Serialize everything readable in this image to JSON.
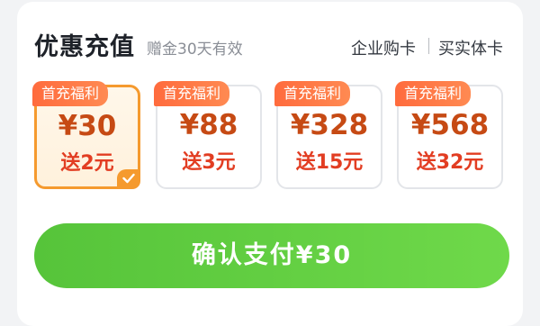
{
  "header": {
    "title": "优惠充值",
    "subtitle": "赠金30天有效",
    "link_corporate": "企业购卡",
    "link_physical": "买实体卡"
  },
  "options": [
    {
      "badge": "首充福利",
      "price": "¥30",
      "bonus": "送2元",
      "selected": true
    },
    {
      "badge": "首充福利",
      "price": "¥88",
      "bonus": "送3元",
      "selected": false
    },
    {
      "badge": "首充福利",
      "price": "¥328",
      "bonus": "送15元",
      "selected": false
    },
    {
      "badge": "首充福利",
      "price": "¥568",
      "bonus": "送32元",
      "selected": false
    }
  ],
  "pay_button": {
    "label": "确认支付¥30"
  },
  "colors": {
    "accent_orange": "#f59a2e",
    "price_text": "#c64a14",
    "bonus_text": "#e23d22",
    "badge_bg": "#ff6b3d",
    "pay_green": "#56c43a"
  },
  "icons": {
    "selected_check": "checkmark-icon"
  }
}
